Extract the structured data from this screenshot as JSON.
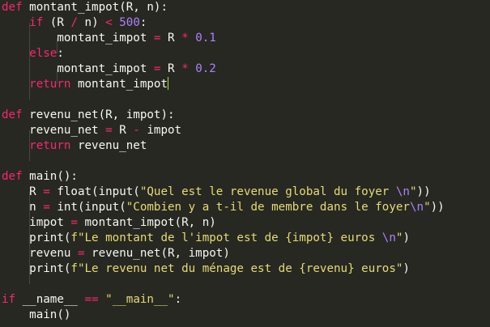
{
  "colors": {
    "background": "#272822",
    "text": "#f8f8f2",
    "keyword": "#f92672",
    "number": "#ae81ff",
    "string": "#e6db74",
    "escape": "#ae81ff",
    "cursor": "#a6e22e"
  },
  "code": {
    "lines": [
      [
        [
          "def",
          "kw"
        ],
        [
          " montant_impot(R, n):",
          "txt"
        ]
      ],
      [
        [
          "    ",
          "txt"
        ],
        [
          "if",
          "kw"
        ],
        [
          " (R ",
          "txt"
        ],
        [
          "/",
          "op"
        ],
        [
          " n) ",
          "txt"
        ],
        [
          "<",
          "op"
        ],
        [
          " ",
          "txt"
        ],
        [
          "500",
          "num"
        ],
        [
          ":",
          "txt"
        ]
      ],
      [
        [
          "        montant_impot ",
          "txt"
        ],
        [
          "=",
          "op"
        ],
        [
          " R ",
          "txt"
        ],
        [
          "*",
          "op"
        ],
        [
          " ",
          "txt"
        ],
        [
          "0.1",
          "num"
        ]
      ],
      [
        [
          "    ",
          "txt"
        ],
        [
          "else",
          "kw"
        ],
        [
          ":",
          "txt"
        ]
      ],
      [
        [
          "        montant_impot ",
          "txt"
        ],
        [
          "=",
          "op"
        ],
        [
          " R ",
          "txt"
        ],
        [
          "*",
          "op"
        ],
        [
          " ",
          "txt"
        ],
        [
          "0.2",
          "num"
        ]
      ],
      [
        [
          "    ",
          "txt"
        ],
        [
          "return",
          "kw"
        ],
        [
          " montant_impot",
          "txt"
        ]
      ],
      [],
      [
        [
          "def",
          "kw"
        ],
        [
          " revenu_net(R, impot):",
          "txt"
        ]
      ],
      [
        [
          "    revenu_net ",
          "txt"
        ],
        [
          "=",
          "op"
        ],
        [
          " R ",
          "txt"
        ],
        [
          "-",
          "op"
        ],
        [
          " impot",
          "txt"
        ]
      ],
      [
        [
          "    ",
          "txt"
        ],
        [
          "return",
          "kw"
        ],
        [
          " revenu_net",
          "txt"
        ]
      ],
      [],
      [
        [
          "def",
          "kw"
        ],
        [
          " main():",
          "txt"
        ]
      ],
      [
        [
          "    R ",
          "txt"
        ],
        [
          "=",
          "op"
        ],
        [
          " float(input(",
          "txt"
        ],
        [
          "\"Quel est le revenue global du foyer ",
          "str"
        ],
        [
          "\\n",
          "esc"
        ],
        [
          "\"",
          "str"
        ],
        [
          "))",
          "txt"
        ]
      ],
      [
        [
          "    n ",
          "txt"
        ],
        [
          "=",
          "op"
        ],
        [
          " int(input(",
          "txt"
        ],
        [
          "\"Combien y a t-il de membre dans le foyer",
          "str"
        ],
        [
          "\\n",
          "esc"
        ],
        [
          "\"",
          "str"
        ],
        [
          "))",
          "txt"
        ]
      ],
      [
        [
          "    impot ",
          "txt"
        ],
        [
          "=",
          "op"
        ],
        [
          " montant_impot(R, n)",
          "txt"
        ]
      ],
      [
        [
          "    print(",
          "txt"
        ],
        [
          "f\"Le montant de l'impot est de {impot} euros ",
          "str"
        ],
        [
          "\\n",
          "esc"
        ],
        [
          "\"",
          "str"
        ],
        [
          ")",
          "txt"
        ]
      ],
      [
        [
          "    revenu ",
          "txt"
        ],
        [
          "=",
          "op"
        ],
        [
          " revenu_net(R, impot)",
          "txt"
        ]
      ],
      [
        [
          "    print(",
          "txt"
        ],
        [
          "f\"Le revenu net du ménage est de {revenu} euros\"",
          "str"
        ],
        [
          ")",
          "txt"
        ]
      ],
      [],
      [
        [
          "if",
          "kw"
        ],
        [
          " __name__ ",
          "txt"
        ],
        [
          "==",
          "op"
        ],
        [
          " ",
          "txt"
        ],
        [
          "\"__main__\"",
          "str"
        ],
        [
          ":",
          "txt"
        ]
      ],
      [
        [
          "    main()",
          "txt"
        ]
      ]
    ],
    "cursor_line": 5
  }
}
